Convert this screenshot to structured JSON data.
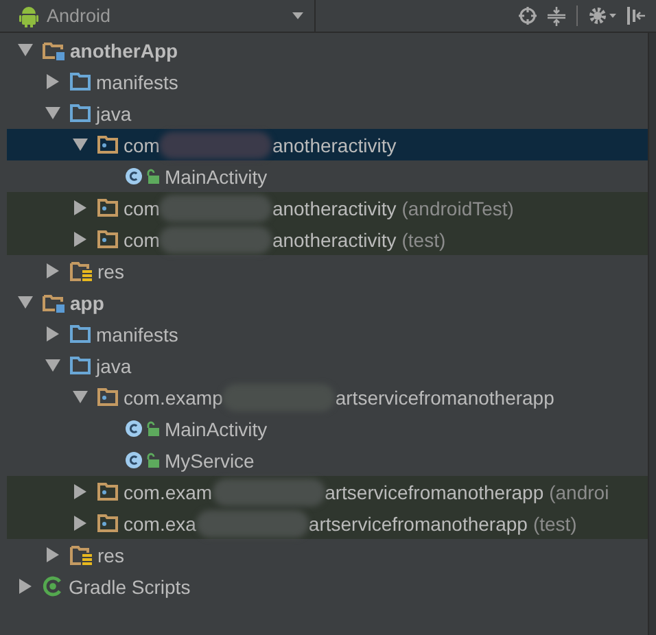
{
  "toolbar": {
    "view": "Android"
  },
  "tree": [
    {
      "kind": "module",
      "label": "anotherApp",
      "expanded": true,
      "selected": false,
      "children": [
        {
          "kind": "folder",
          "label": "manifests",
          "expanded": false,
          "selected": false
        },
        {
          "kind": "folder",
          "label": "java",
          "expanded": true,
          "selected": false,
          "children": [
            {
              "kind": "package",
              "prefix": "com",
              "suffix": "anotheractivity",
              "test_source": false,
              "expanded": true,
              "selected": true,
              "children": [
                {
                  "kind": "class",
                  "label": "MainActivity",
                  "selected": false
                }
              ]
            },
            {
              "kind": "package",
              "prefix": "com",
              "suffix": "anotheractivity",
              "note": "(androidTest)",
              "test_source": true,
              "expanded": false,
              "selected": false
            },
            {
              "kind": "package",
              "prefix": "com",
              "suffix": "anotheractivity",
              "note": "(test)",
              "test_source": true,
              "expanded": false,
              "selected": false
            }
          ]
        },
        {
          "kind": "res",
          "label": "res",
          "expanded": false,
          "selected": false
        }
      ]
    },
    {
      "kind": "module",
      "label": "app",
      "expanded": true,
      "selected": false,
      "children": [
        {
          "kind": "folder",
          "label": "manifests",
          "expanded": false,
          "selected": false
        },
        {
          "kind": "folder",
          "label": "java",
          "expanded": true,
          "selected": false,
          "children": [
            {
              "kind": "package",
              "prefix": "com.examp",
              "suffix": "artservicefromanotherapp",
              "test_source": false,
              "expanded": true,
              "selected": false,
              "children": [
                {
                  "kind": "class",
                  "label": "MainActivity",
                  "selected": false
                },
                {
                  "kind": "class",
                  "label": "MyService",
                  "selected": false
                }
              ]
            },
            {
              "kind": "package",
              "prefix": "com.exam",
              "suffix": "artservicefromanotherapp",
              "note": "(androi",
              "test_source": true,
              "expanded": false,
              "selected": false
            },
            {
              "kind": "package",
              "prefix": "com.exa",
              "suffix": "artservicefromanotherapp",
              "note": "(test)",
              "test_source": true,
              "expanded": false,
              "selected": false
            }
          ]
        },
        {
          "kind": "res",
          "label": "res",
          "expanded": false,
          "selected": false
        }
      ]
    },
    {
      "kind": "gradle",
      "label": "Gradle Scripts",
      "expanded": false,
      "selected": false
    }
  ]
}
